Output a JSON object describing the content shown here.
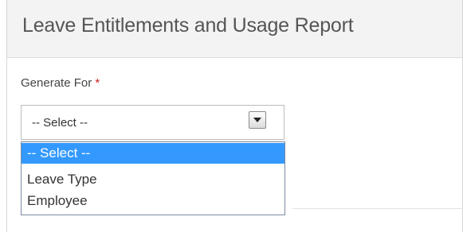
{
  "header": {
    "title": "Leave Entitlements and Usage Report"
  },
  "form": {
    "generate_for": {
      "label": "Generate For",
      "required_marker": "*",
      "selected_value": "-- Select --",
      "options": [
        {
          "label": "-- Select --",
          "highlighted": true
        },
        {
          "label": "Leave Type",
          "highlighted": false
        },
        {
          "label": "Employee",
          "highlighted": false
        }
      ]
    }
  },
  "icons": {
    "dropdown_arrow": "chevron-down-icon"
  },
  "colors": {
    "highlight": "#3399ff",
    "required": "#cc2222",
    "header_bg": "#f3f3f3"
  }
}
